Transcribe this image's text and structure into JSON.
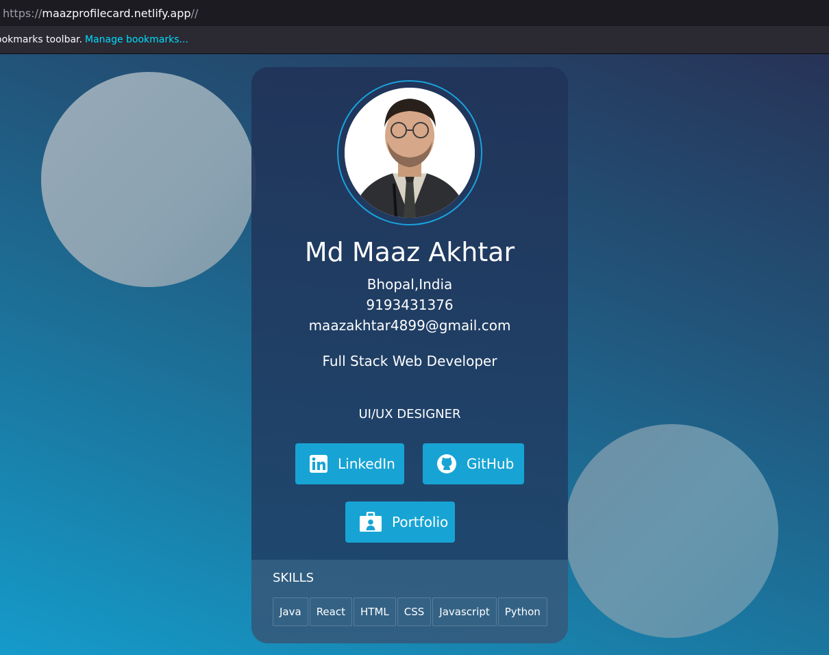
{
  "browser": {
    "url_scheme": "https://",
    "url_host": "maazprofilecard.netlify.app",
    "url_rest": "//",
    "bookmarks_text": "ookmarks toolbar.",
    "bookmarks_link": "Manage bookmarks..."
  },
  "profile": {
    "name": "Md Maaz Akhtar",
    "location": "Bhopal,India",
    "phone": "9193431376",
    "email": "maazakhtar4899@gmail.com",
    "title": "Full Stack Web Developer",
    "subtitle": "UI/UX DESIGNER"
  },
  "links": {
    "linkedin": "LinkedIn",
    "github": "GitHub",
    "portfolio": "Portfolio"
  },
  "skills": {
    "heading": "SKILLS",
    "items": [
      "Java",
      "React",
      "HTML",
      "CSS",
      "Javascript",
      "Python"
    ]
  },
  "colors": {
    "accent": "#17a4d4",
    "link": "#00ddff"
  }
}
